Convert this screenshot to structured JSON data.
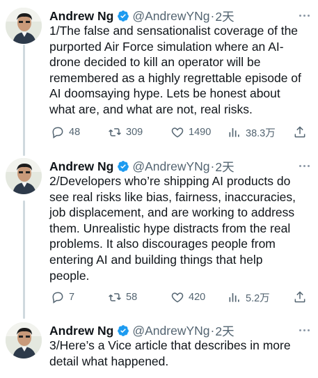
{
  "tweets": [
    {
      "name": "Andrew Ng",
      "handle": "@AndrewYNg",
      "dot": "·",
      "time": "2天",
      "lines": [
        "1/The false and sensationalist coverage of the",
        "purported Air Force simulation where an AI-",
        "drone decided to kill an operator will be",
        "remembered as a highly regrettable episode of",
        "AI doomsaying hype. Lets be honest about",
        "what are, and what are not, real risks."
      ],
      "replies": "48",
      "retweets": "309",
      "likes": "1490",
      "views": "38.3万"
    },
    {
      "name": "Andrew Ng",
      "handle": "@AndrewYNg",
      "dot": "·",
      "time": "2天",
      "lines": [
        "2/Developers who’re shipping AI products do",
        "see real risks like bias, fairness, inaccuracies,",
        "job displacement, and are working to address",
        "them. Unrealistic hype distracts from the real",
        "problems. It also discourages people from",
        "entering AI and building things that help",
        "people."
      ],
      "replies": "7",
      "retweets": "58",
      "likes": "420",
      "views": "5.2万"
    },
    {
      "name": "Andrew Ng",
      "handle": "@AndrewYNg",
      "dot": "·",
      "time": "2天",
      "lines": [
        "3/Here’s a Vice article that describes in more",
        "detail what happened."
      ]
    }
  ],
  "colors": {
    "text": "#0f1419",
    "secondary": "#536471",
    "verified_badge": "#1d9bf0",
    "thread_line": "#cfd9de"
  },
  "icons": {
    "reply": "reply-icon",
    "retweet": "retweet-icon",
    "like": "like-icon",
    "views": "views-icon",
    "share": "share-icon",
    "verified": "verified-badge-icon",
    "more": "more-options-icon"
  }
}
